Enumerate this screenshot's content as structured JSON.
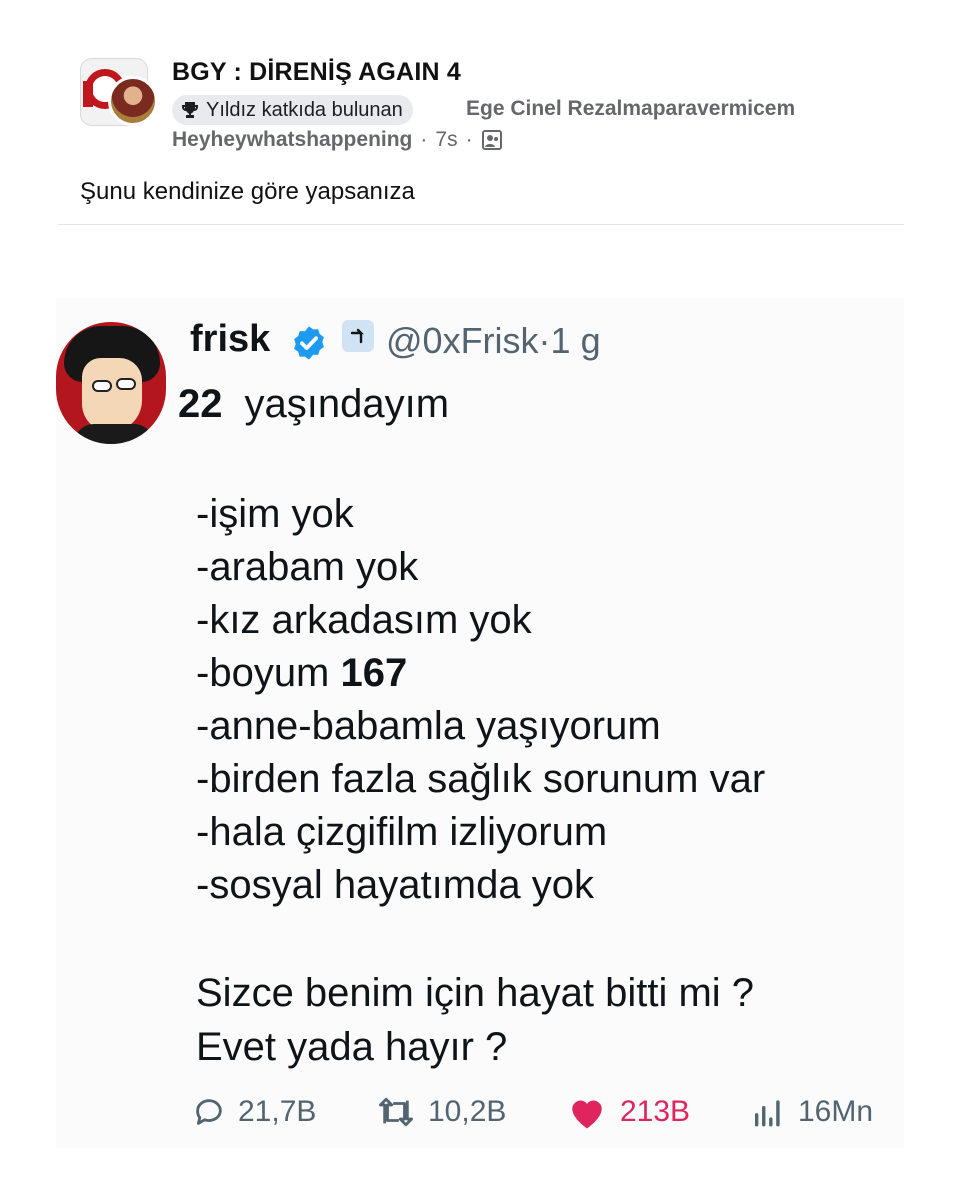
{
  "post": {
    "group_title": "BGY : DİRENİŞ AGAIN 4",
    "badge_label": "Yıldız katkıda bulunan",
    "author_line1": "Ege Cinel Rezalmaparavermicem",
    "author_line2": "Heyheywhatshappening",
    "time_sep1": "·",
    "time": "7s",
    "time_sep2": "·",
    "text": "Şunu kendinize göre yapsanıza"
  },
  "tweet": {
    "name": "frisk",
    "handle": "@0xFrisk",
    "age_sep": "·",
    "age": "1 g",
    "intro_num": "22",
    "intro_text": "yaşındayım",
    "list": [
      {
        "text": "-işim yok"
      },
      {
        "text": "-arabam yok"
      },
      {
        "text": "-kız arkadasım yok"
      },
      {
        "text": "-boyum ",
        "bold": "167"
      },
      {
        "text": "-anne-babamla yaşıyorum"
      },
      {
        "text": "-birden fazla sağlık sorunum var"
      },
      {
        "text": "-hala çizgifilm izliyorum"
      },
      {
        "text": "-sosyal hayatımda yok"
      }
    ],
    "question_line1": "Sizce benim için hayat bitti mi ?",
    "question_line2": "Evet yada hayır ?",
    "stats": {
      "replies": "21,7B",
      "retweets": "10,2B",
      "likes": "213B",
      "views": "16Mn"
    },
    "colors": {
      "verified": "#1d9bf0",
      "like": "#e0245e"
    }
  },
  "icons": {
    "trophy": "trophy-icon",
    "privacy": "photo-privacy-icon",
    "verified": "verified-badge-icon",
    "affiliate": "affiliate-badge-icon",
    "reply": "reply-icon",
    "retweet": "retweet-icon",
    "like": "heart-icon",
    "views": "views-icon"
  }
}
